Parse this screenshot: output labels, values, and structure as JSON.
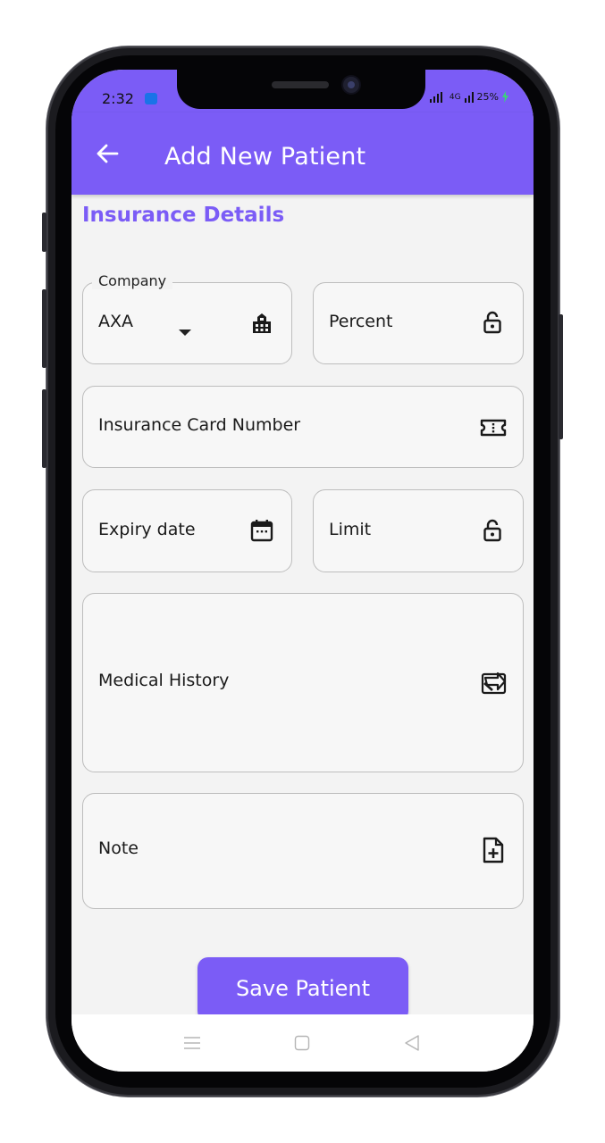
{
  "status_bar": {
    "time": "2:32",
    "network_label": "4G",
    "battery": "25%"
  },
  "app_bar": {
    "title": "Add New Patient",
    "back_icon": "arrow-left-icon"
  },
  "section": {
    "title": "Insurance Details"
  },
  "fields": {
    "company": {
      "label": "Company",
      "value": "AXA",
      "icon": "building-icon"
    },
    "percent": {
      "label": "Percent",
      "icon": "lock-open-icon"
    },
    "card_number": {
      "label": "Insurance Card Number",
      "icon": "ticket-icon"
    },
    "expiry": {
      "label": "Expiry date",
      "icon": "calendar-icon"
    },
    "limit": {
      "label": "Limit",
      "icon": "lock-open-icon"
    },
    "medical_history": {
      "label": "Medical History",
      "icon": "signature-icon"
    },
    "note": {
      "label": "Note",
      "icon": "file-plus-icon"
    }
  },
  "actions": {
    "save_label": "Save Patient"
  },
  "nav": {
    "menu_icon": "menu-icon",
    "home_icon": "square-icon",
    "back_icon": "triangle-back-icon"
  },
  "colors": {
    "primary": "#7b5cf6",
    "field_border": "#bdbdbd",
    "background": "#f3f3f3"
  }
}
